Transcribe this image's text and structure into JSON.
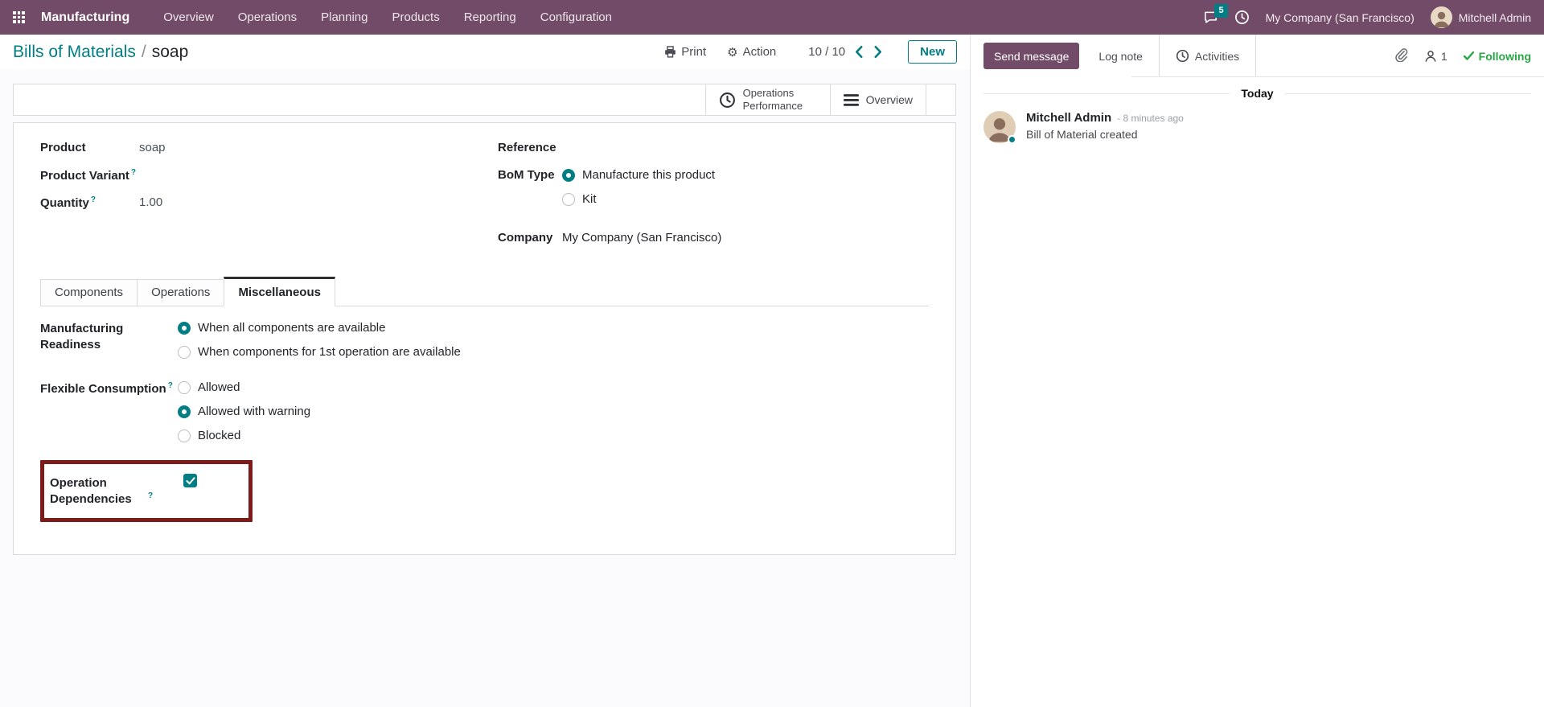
{
  "ui": {
    "help_marker": "?"
  },
  "colors": {
    "brand": "#714B67",
    "accent": "#017E84",
    "highlight": "#7d1a1a",
    "green": "#28a745"
  },
  "nav": {
    "app_name": "Manufacturing",
    "items": [
      {
        "label": "Overview"
      },
      {
        "label": "Operations"
      },
      {
        "label": "Planning"
      },
      {
        "label": "Products"
      },
      {
        "label": "Reporting"
      },
      {
        "label": "Configuration"
      }
    ],
    "badge_count": "5",
    "company": "My Company (San Francisco)",
    "user": "Mitchell Admin"
  },
  "control_panel": {
    "breadcrumb_root": "Bills of Materials",
    "breadcrumb_sep": "/",
    "breadcrumb_current": "soap",
    "print_label": "Print",
    "action_label": "Action",
    "pager": "10 / 10",
    "new_label": "New"
  },
  "stat_buttons": {
    "operations_performance": "Operations Performance",
    "overview": "Overview"
  },
  "form": {
    "product_label": "Product",
    "product_value": "soap",
    "product_variant_label": "Product Variant",
    "quantity_label": "Quantity",
    "quantity_value": "1.00",
    "reference_label": "Reference",
    "bom_type_label": "BoM Type",
    "bom_options": [
      {
        "label": "Manufacture this product",
        "selected": true
      },
      {
        "label": "Kit",
        "selected": false
      }
    ],
    "company_label": "Company",
    "company_value": "My Company (San Francisco)",
    "tabs": [
      {
        "label": "Components",
        "active": false
      },
      {
        "label": "Operations",
        "active": false
      },
      {
        "label": "Miscellaneous",
        "active": true
      }
    ],
    "misc": {
      "readiness_label": "Manufacturing Readiness",
      "readiness_options": [
        {
          "label": "When all components are available",
          "selected": true
        },
        {
          "label": "When components for 1st operation are available",
          "selected": false
        }
      ],
      "consumption_label": "Flexible Consumption",
      "consumption_options": [
        {
          "label": "Allowed",
          "selected": false
        },
        {
          "label": "Allowed with warning",
          "selected": true
        },
        {
          "label": "Blocked",
          "selected": false
        }
      ],
      "dependencies_label": "Operation Dependencies",
      "dependencies_checked": true
    }
  },
  "chatter": {
    "send_message": "Send message",
    "log_note": "Log note",
    "activities": "Activities",
    "followers_count": "1",
    "following": "Following",
    "date_divider": "Today",
    "message": {
      "author": "Mitchell Admin",
      "time": "- 8 minutes ago",
      "body": "Bill of Material created"
    }
  }
}
